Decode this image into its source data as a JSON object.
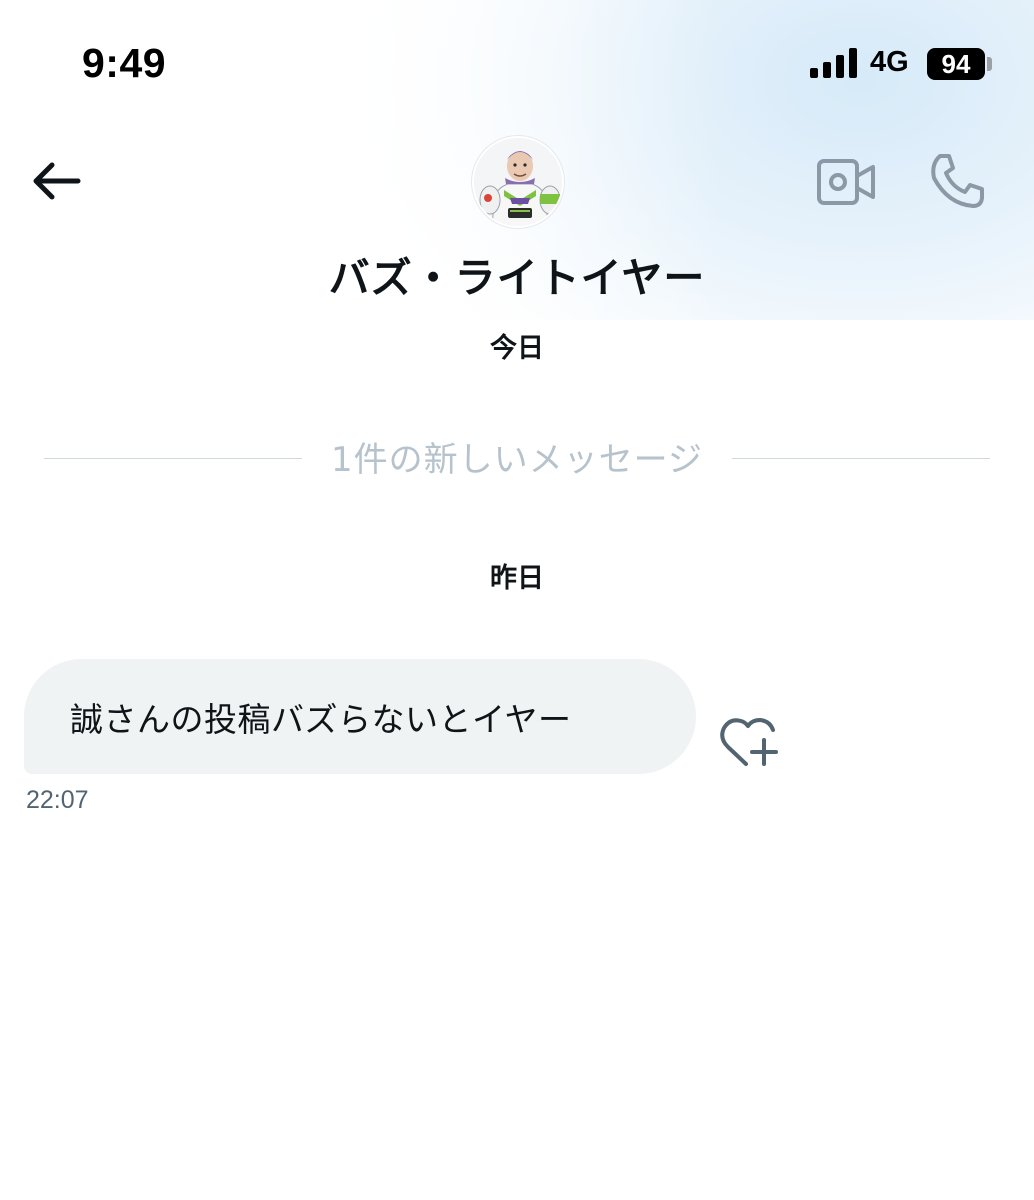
{
  "status_bar": {
    "time": "9:49",
    "network": "4G",
    "battery": "94"
  },
  "header": {
    "contact_name": "バズ・ライトイヤー",
    "icons": {
      "back": "arrow-left-icon",
      "video": "video-camera-icon",
      "phone": "phone-icon"
    }
  },
  "conversation": {
    "date_today": "今日",
    "new_messages_divider": "1件の新しいメッセージ",
    "date_yesterday": "昨日",
    "messages": [
      {
        "text": "誠さんの投稿バズらないとイヤー",
        "time": "22:07",
        "reaction_icon": "heart-plus-icon"
      }
    ]
  },
  "colors": {
    "bubble": "#eff3f4",
    "icon_gray": "#8b98a5",
    "divider_text": "#b6c3cc",
    "header_tint": "#d6eaf8"
  }
}
